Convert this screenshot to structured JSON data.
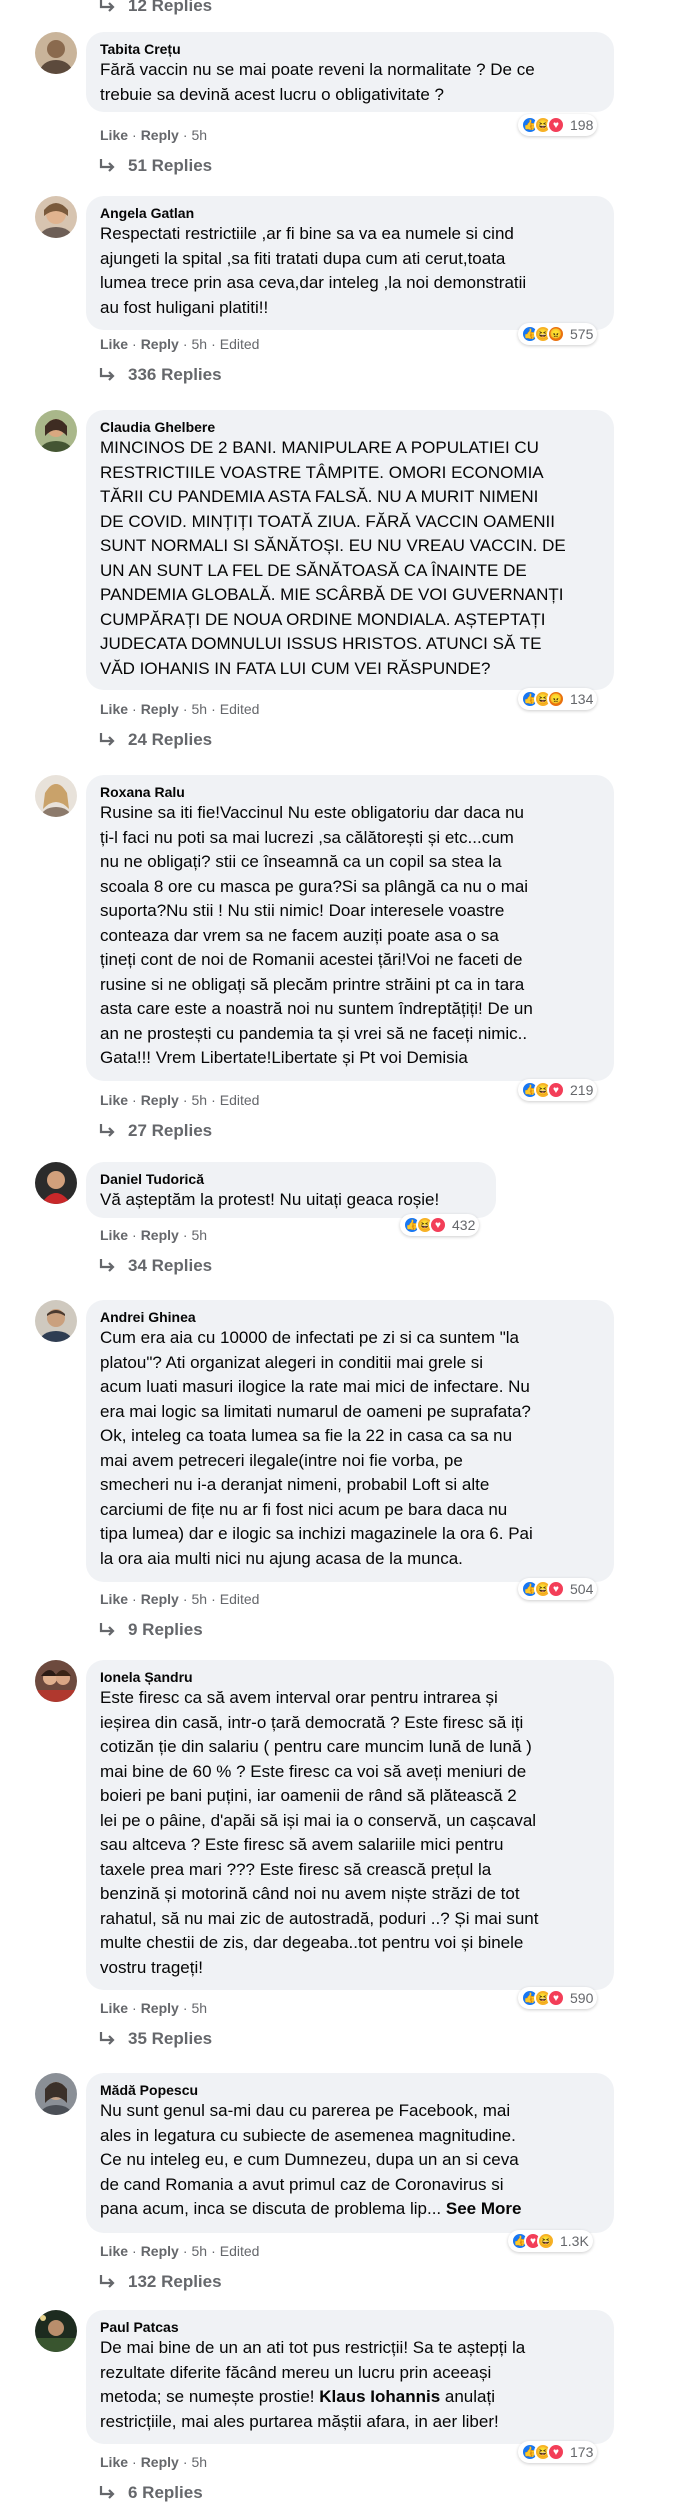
{
  "top_replies": "12 Replies",
  "labels": {
    "like": "Like",
    "reply": "Reply",
    "dot": "·",
    "edited": "Edited"
  },
  "colors": {
    "bubble": "#f0f2f5",
    "meta": "#65676b",
    "like": "#1877f2",
    "love": "#f33e58",
    "haha": "#f7b125",
    "angry": "#e9710f"
  },
  "comments": [
    {
      "author": "Tabita Crețu",
      "lines": [
        "Fără vaccin nu se mai poate reveni la normalitate ? De ce",
        "trebuie sa devină acest lucru o obligativitate ?"
      ],
      "time": "5h",
      "edited": false,
      "reactions": [
        "like-icon",
        "haha-icon",
        "love-icon"
      ],
      "reaction_count": "198",
      "replies": "51 Replies"
    },
    {
      "author": "Angela Gatlan",
      "lines": [
        "Respectati restrictiile ,ar fi bine sa va ea numele si cind",
        "ajungeti la spital ,sa fiti tratati dupa cum ati cerut,toata",
        "lumea trece prin asa ceva,dar inteleg ,la noi demonstratii",
        "au fost huligani platiti!!"
      ],
      "time": "5h",
      "edited": true,
      "reactions": [
        "like-icon",
        "haha-icon",
        "angry-icon"
      ],
      "reaction_count": "575",
      "replies": "336 Replies"
    },
    {
      "author": "Claudia Ghelbere",
      "lines": [
        "MINCINOS DE 2 BANI. MANIPULARE A POPULATIEI CU",
        "RESTRICTIILE VOASTRE TÂMPITE. OMORI ECONOMIA",
        "TĂRII CU PANDEMIA ASTA FALSĂ. NU A MURIT NIMENI",
        "DE COVID. MINȚIȚI TOATĂ ZIUA. FĂRĂ VACCIN OAMENII",
        "SUNT NORMALI SI SĂNĂTOȘI. EU NU VREAU VACCIN. DE",
        "UN AN SUNT LA FEL DE SĂNĂTOASĂ CA ÎNAINTE DE",
        "PANDEMIA GLOBALĂ. MIE SCÂRBĂ DE VOI GUVERNANȚI",
        "CUMPĂRAȚI DE NOUA ORDINE MONDIALA. AȘTEPTAȚI",
        "JUDECATA DOMNULUI ISSUS HRISTOS. ATUNCI SĂ TE",
        "VĂD IOHANIS IN FATA LUI CUM VEI RĂSPUNDE?"
      ],
      "time": "5h",
      "edited": true,
      "reactions": [
        "like-icon",
        "haha-icon",
        "angry-icon"
      ],
      "reaction_count": "134",
      "replies": "24 Replies"
    },
    {
      "author": "Roxana Ralu",
      "lines": [
        "Rusine sa iti fie!Vaccinul Nu este obligatoriu dar daca nu",
        "ți-l faci nu poti sa mai lucrezi ,sa călătorești și etc...cum",
        "nu ne obligați? stii ce înseamnă ca un copil sa stea la",
        "scoala 8 ore cu masca pe gura?Si sa plângă ca nu o mai",
        "suporta?Nu stii ! Nu stii nimic! Doar interesele voastre",
        "conteaza dar vrem sa ne facem auziți poate asa o sa",
        "țineți cont de noi de Romanii acestei țări!Voi ne faceti de",
        "rusine si ne obligați să plecăm printre străini pt ca in tara",
        "asta care este a noastră noi nu suntem îndreptățiți! De un",
        "an ne prostești cu pandemia ta și vrei să ne faceți nimic..",
        "Gata!!! Vrem Libertate!Libertate și Pt voi Demisia"
      ],
      "time": "5h",
      "edited": true,
      "reactions": [
        "like-icon",
        "haha-icon",
        "love-icon"
      ],
      "reaction_count": "219",
      "replies": "27 Replies"
    },
    {
      "author": "Daniel Tudorică",
      "lines": [
        "Vă așteptăm la protest! Nu uitați geaca roșie!"
      ],
      "time": "5h",
      "edited": false,
      "reactions": [
        "like-icon",
        "haha-icon",
        "love-icon"
      ],
      "reaction_count": "432",
      "replies": "34 Replies"
    },
    {
      "author": "Andrei Ghinea",
      "lines": [
        "Cum era aia cu 10000 de infectati pe zi si ca suntem \"la",
        "platou\"? Ati organizat alegeri in conditii mai grele si",
        "acum luati masuri ilogice la rate mai mici de infectare. Nu",
        "era mai logic sa limitati numarul de oameni pe suprafata?",
        "Ok, inteleg ca toata lumea sa fie la 22 in casa ca sa nu",
        "mai avem petreceri ilegale(intre noi fie vorba, pe",
        "smecheri nu i-a deranjat nimeni, probabil Loft si alte",
        "carciumi de fițe nu ar fi fost nici acum pe bara daca nu",
        "tipa lumea) dar e ilogic sa inchizi magazinele la ora 6. Pai",
        "la ora aia multi nici nu ajung acasa de la munca."
      ],
      "time": "5h",
      "edited": true,
      "reactions": [
        "like-icon",
        "haha-icon",
        "love-icon"
      ],
      "reaction_count": "504",
      "replies": "9 Replies"
    },
    {
      "author": "Ionela Șandru",
      "lines": [
        "Este firesc ca să avem interval orar pentru intrarea și",
        "ieșirea din casă, intr-o țară democrată ? Este firesc să iți",
        "cotizăn ție din salariu ( pentru care muncim lună de lună )",
        "mai bine de 60 % ? Este firesc ca voi să aveți meniuri de",
        "boieri pe bani puțini, iar oamenii de rând să plătească 2",
        "lei pe o pâine, d'apăi să iși mai ia o conservă, un cașcaval",
        "sau altceva ? Este firesc să avem salariile mici pentru",
        "taxele prea mari ??? Este firesc să crească prețul la",
        "benzină și motorină când noi nu avem niște străzi de tot",
        "rahatul, să nu mai zic de autostradă, poduri ..? Și mai sunt",
        "multe chestii de zis, dar degeaba..tot pentru voi și binele",
        "vostru trageți!"
      ],
      "time": "5h",
      "edited": false,
      "reactions": [
        "like-icon",
        "haha-icon",
        "love-icon"
      ],
      "reaction_count": "590",
      "replies": "35 Replies"
    },
    {
      "author": "Mădă Popescu",
      "lines": [
        "Nu sunt genul sa-mi dau cu parerea pe Facebook, mai",
        "ales in legatura cu subiecte de asemenea magnitudine.",
        "Ce nu inteleg eu, e cum Dumnezeu, dupa un an si ceva",
        "de cand Romania a avut primul caz de Coronavirus si",
        "pana acum, inca se discuta de problema lip..."
      ],
      "see_more": "See More",
      "time": "5h",
      "edited": true,
      "reactions": [
        "like-icon",
        "love-icon",
        "haha-icon"
      ],
      "reaction_count": "1.3K",
      "replies": "132 Replies"
    },
    {
      "author": "Paul Patcas",
      "lines": [
        "De mai bine de un an ati tot pus restricții! Sa te aștepți la",
        "rezultate diferite făcând mereu un lucru prin aceeași",
        "metoda; se numește prostie!",
        "restricțiile, mai ales purtarea măștii afara, in aer liber!"
      ],
      "mention_prefix": "metoda; se numește prostie! ",
      "mention": "Klaus Iohannis",
      "mention_suffix": " anulați",
      "time": "5h",
      "edited": false,
      "reactions": [
        "like-icon",
        "haha-icon",
        "love-icon"
      ],
      "reaction_count": "173",
      "replies": "6 Replies"
    }
  ]
}
